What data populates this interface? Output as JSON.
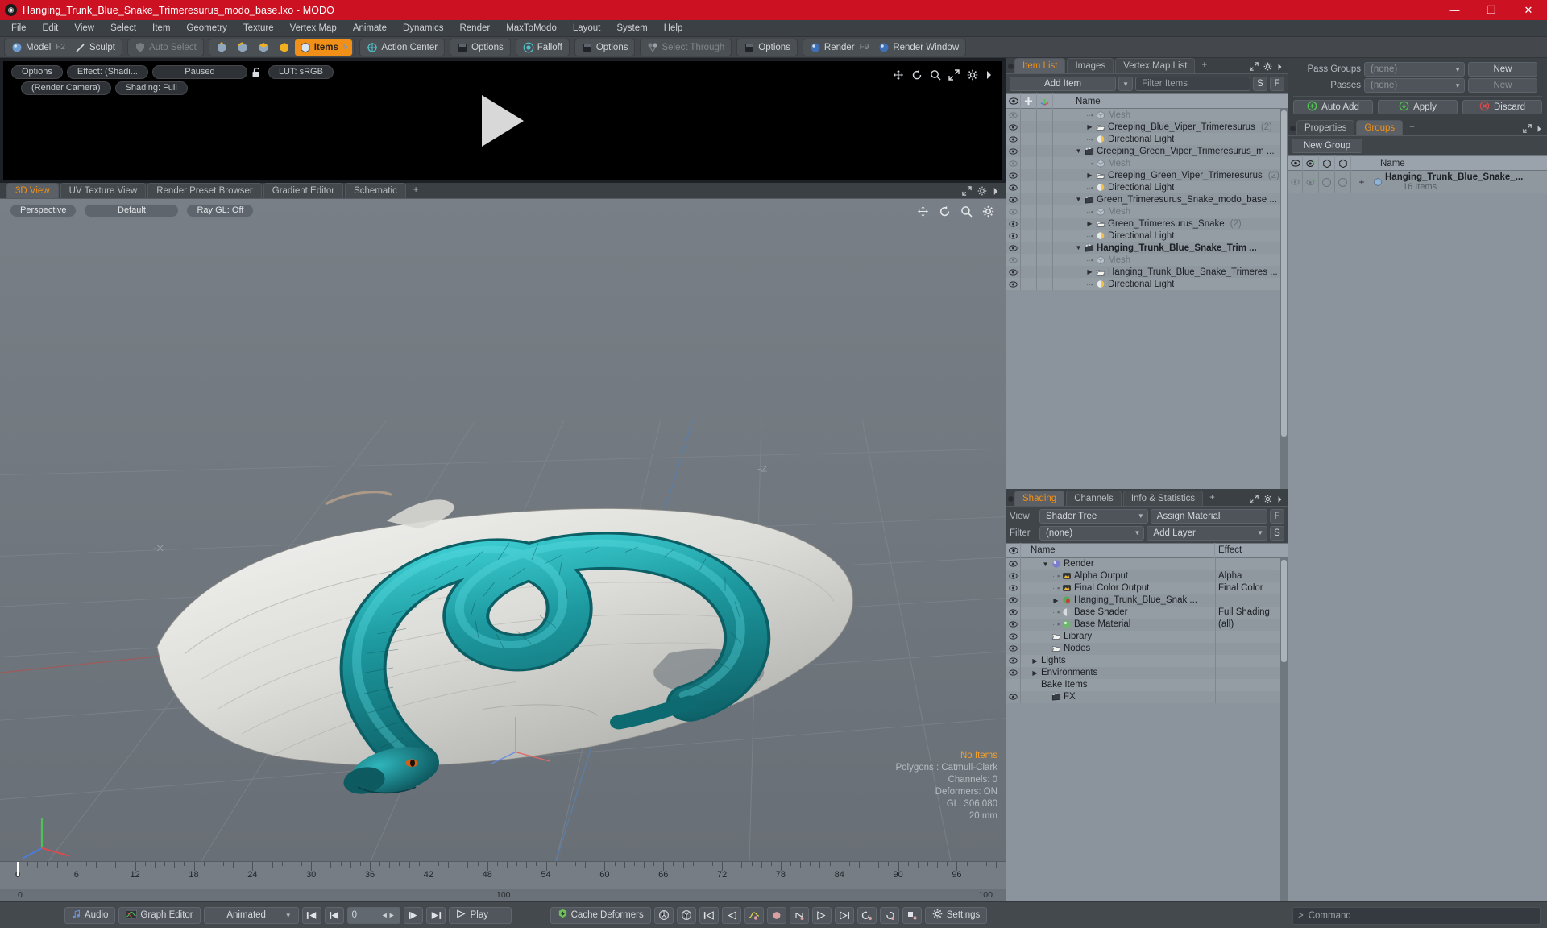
{
  "window": {
    "title": "Hanging_Trunk_Blue_Snake_Trimeresurus_modo_base.lxo - MODO",
    "minimize": "—",
    "maximize": "❐",
    "close": "✕",
    "app_glyph": "◉"
  },
  "menubar": [
    "File",
    "Edit",
    "View",
    "Select",
    "Item",
    "Geometry",
    "Texture",
    "Vertex Map",
    "Animate",
    "Dynamics",
    "Render",
    "MaxToModo",
    "Layout",
    "System",
    "Help"
  ],
  "modebar": {
    "model": "Model",
    "model_hotkey": "F2",
    "sculpt": "Sculpt",
    "auto_select": "Auto Select",
    "items": "Items",
    "items_hotkey": "5",
    "action_center": "Action Center",
    "options1": "Options",
    "falloff": "Falloff",
    "options2": "Options",
    "select_through": "Select Through",
    "options3": "Options",
    "render": "Render",
    "render_hotkey": "F9",
    "render_window": "Render Window"
  },
  "render_preview": {
    "options": "Options",
    "effect": "Effect: (Shadi...",
    "paused": "Paused",
    "lut": "LUT: sRGB",
    "camera": "(Render Camera)",
    "shading": "Shading: Full"
  },
  "viewport": {
    "tabs": [
      {
        "label": "3D View",
        "selected": true
      },
      {
        "label": "UV Texture View",
        "selected": false
      },
      {
        "label": "Render Preset Browser",
        "selected": false
      },
      {
        "label": "Gradient Editor",
        "selected": false
      },
      {
        "label": "Schematic",
        "selected": false
      }
    ],
    "add_tab": "+",
    "controls": [
      "Perspective",
      "Default",
      "Ray GL: Off"
    ],
    "axis_labels": {
      "neg_z": "-Z",
      "neg_x": "-X"
    },
    "stats": {
      "no_items": "No Items",
      "polygons": "Polygons : Catmull-Clark",
      "channels": "Channels: 0",
      "deformers": "Deformers: ON",
      "gl": "GL: 306,080",
      "scale": "20 mm"
    }
  },
  "timeline": {
    "ticks": [
      0,
      6,
      12,
      18,
      24,
      30,
      36,
      42,
      48,
      54,
      60,
      66,
      72,
      78,
      84,
      90,
      96
    ],
    "range_start": "0",
    "range_mid": "100",
    "range_end": "100",
    "playhead": 0
  },
  "item_list": {
    "tabs": [
      {
        "label": "Item List",
        "selected": true
      },
      {
        "label": "Images",
        "selected": false
      },
      {
        "label": "Vertex Map List",
        "selected": false
      }
    ],
    "add_tab": "+",
    "add_item": "Add Item",
    "filter_placeholder": "Filter Items",
    "btn_s": "S",
    "btn_f": "F",
    "col_name": "Name",
    "rows": [
      {
        "label": "Mesh",
        "indent": 2,
        "icon": "mesh-icon",
        "style": "dim",
        "marker": "dots",
        "count": ""
      },
      {
        "label": "Creeping_Blue_Viper_Trimeresurus",
        "indent": 2,
        "icon": "folder-icon",
        "style": "normal",
        "marker": "arrow",
        "count": "(2)"
      },
      {
        "label": "Directional Light",
        "indent": 2,
        "icon": "light-icon",
        "style": "normal",
        "marker": "dots",
        "count": ""
      },
      {
        "label": "Creeping_Green_Viper_Trimeresurus_m ...",
        "indent": 1,
        "icon": "scene-icon",
        "style": "normal",
        "marker": "open",
        "count": ""
      },
      {
        "label": "Mesh",
        "indent": 2,
        "icon": "mesh-icon",
        "style": "dim",
        "marker": "dots",
        "count": ""
      },
      {
        "label": "Creeping_Green_Viper_Trimeresurus",
        "indent": 2,
        "icon": "folder-icon",
        "style": "normal",
        "marker": "arrow",
        "count": "(2)"
      },
      {
        "label": "Directional Light",
        "indent": 2,
        "icon": "light-icon",
        "style": "normal",
        "marker": "dots",
        "count": ""
      },
      {
        "label": "Green_Trimeresurus_Snake_modo_base ...",
        "indent": 1,
        "icon": "scene-icon",
        "style": "normal",
        "marker": "open",
        "count": ""
      },
      {
        "label": "Mesh",
        "indent": 2,
        "icon": "mesh-icon",
        "style": "dim",
        "marker": "dots",
        "count": ""
      },
      {
        "label": "Green_Trimeresurus_Snake",
        "indent": 2,
        "icon": "folder-icon",
        "style": "normal",
        "marker": "arrow",
        "count": "(2)"
      },
      {
        "label": "Directional Light",
        "indent": 2,
        "icon": "light-icon",
        "style": "normal",
        "marker": "dots",
        "count": ""
      },
      {
        "label": "Hanging_Trunk_Blue_Snake_Trim ...",
        "indent": 1,
        "icon": "scene-icon",
        "style": "bold",
        "marker": "open",
        "count": ""
      },
      {
        "label": "Mesh",
        "indent": 2,
        "icon": "mesh-icon",
        "style": "dim",
        "marker": "dots",
        "count": ""
      },
      {
        "label": "Hanging_Trunk_Blue_Snake_Trimeres ...",
        "indent": 2,
        "icon": "folder-icon",
        "style": "normal",
        "marker": "arrow",
        "count": ""
      },
      {
        "label": "Directional Light",
        "indent": 2,
        "icon": "light-icon",
        "style": "normal",
        "marker": "dots",
        "count": ""
      }
    ]
  },
  "shading": {
    "tabs": [
      {
        "label": "Shading",
        "selected": true
      },
      {
        "label": "Channels",
        "selected": false
      },
      {
        "label": "Info & Statistics",
        "selected": false
      }
    ],
    "add_tab": "+",
    "view_label": "View",
    "view_value": "Shader Tree",
    "assign_material": "Assign Material",
    "btn_f": "F",
    "filter_label": "Filter",
    "filter_value": "(none)",
    "add_layer": "Add Layer",
    "btn_s": "S",
    "col_name": "Name",
    "col_effect": "Effect",
    "rows": [
      {
        "label": "Render",
        "indent": 1,
        "icon": "render-sphere-icon",
        "marker": "open",
        "effect": "",
        "has_caret": false
      },
      {
        "label": "Alpha Output",
        "indent": 2,
        "icon": "output-icon",
        "marker": "dots",
        "effect": "Alpha",
        "has_caret": true
      },
      {
        "label": "Final Color Output",
        "indent": 2,
        "icon": "output-icon",
        "marker": "dots",
        "effect": "Final Color",
        "has_caret": true
      },
      {
        "label": "Hanging_Trunk_Blue_Snak ...",
        "indent": 2,
        "icon": "material-red-icon",
        "marker": "arrow",
        "effect": "",
        "has_caret": true
      },
      {
        "label": "Base Shader",
        "indent": 2,
        "icon": "shader-icon",
        "marker": "dots",
        "effect": "Full Shading",
        "has_caret": true
      },
      {
        "label": "Base Material",
        "indent": 2,
        "icon": "material-green-icon",
        "marker": "dots",
        "effect": "(all)",
        "has_caret": true
      },
      {
        "label": "Library",
        "indent": 1,
        "icon": "folder-icon",
        "marker": "none",
        "effect": "",
        "has_caret": false
      },
      {
        "label": "Nodes",
        "indent": 1,
        "icon": "folder-icon",
        "marker": "none",
        "effect": "",
        "has_caret": false
      },
      {
        "label": "Lights",
        "indent": 0,
        "icon": "none",
        "marker": "arrow",
        "effect": "",
        "has_caret": false
      },
      {
        "label": "Environments",
        "indent": 0,
        "icon": "none",
        "marker": "arrow",
        "effect": "",
        "has_caret": false
      },
      {
        "label": "Bake Items",
        "indent": 0,
        "icon": "none",
        "marker": "none",
        "effect": "",
        "has_caret": false
      },
      {
        "label": "FX",
        "indent": 1,
        "icon": "scene-icon",
        "marker": "none",
        "effect": "",
        "has_caret": false
      }
    ]
  },
  "passes": {
    "pass_groups_label": "Pass Groups",
    "pass_groups_value": "(none)",
    "pass_groups_new": "New",
    "passes_label": "Passes",
    "passes_value": "(none)",
    "passes_new": "New",
    "auto_add": "Auto Add",
    "apply": "Apply",
    "discard": "Discard"
  },
  "groups": {
    "tabs": [
      {
        "label": "Properties",
        "selected": false
      },
      {
        "label": "Groups",
        "selected": true
      }
    ],
    "add_tab": "+",
    "new_group": "New Group",
    "col_name": "Name",
    "rows": [
      {
        "label": "Hanging_Trunk_Blue_Snake_...",
        "sub": "16 Items"
      }
    ]
  },
  "bottombar": {
    "audio": "Audio",
    "graph_editor": "Graph Editor",
    "animated": "Animated",
    "frame_value": "0",
    "play": "Play",
    "cache_deformers": "Cache Deformers",
    "settings": "Settings",
    "first_frame": "|◀",
    "prev_frame": "◀|",
    "next_frame": "|▶",
    "last_frame": "▶|"
  },
  "command": {
    "prompt": ">",
    "placeholder": "Command"
  },
  "colors": {
    "title_bar": "#cc1122",
    "accent_orange": "#f09018",
    "panel_bg": "#3c4146",
    "tree_bg": "#8b949c",
    "viewport_bg": "#70777e",
    "snake_teal": "#1d8a8e"
  }
}
